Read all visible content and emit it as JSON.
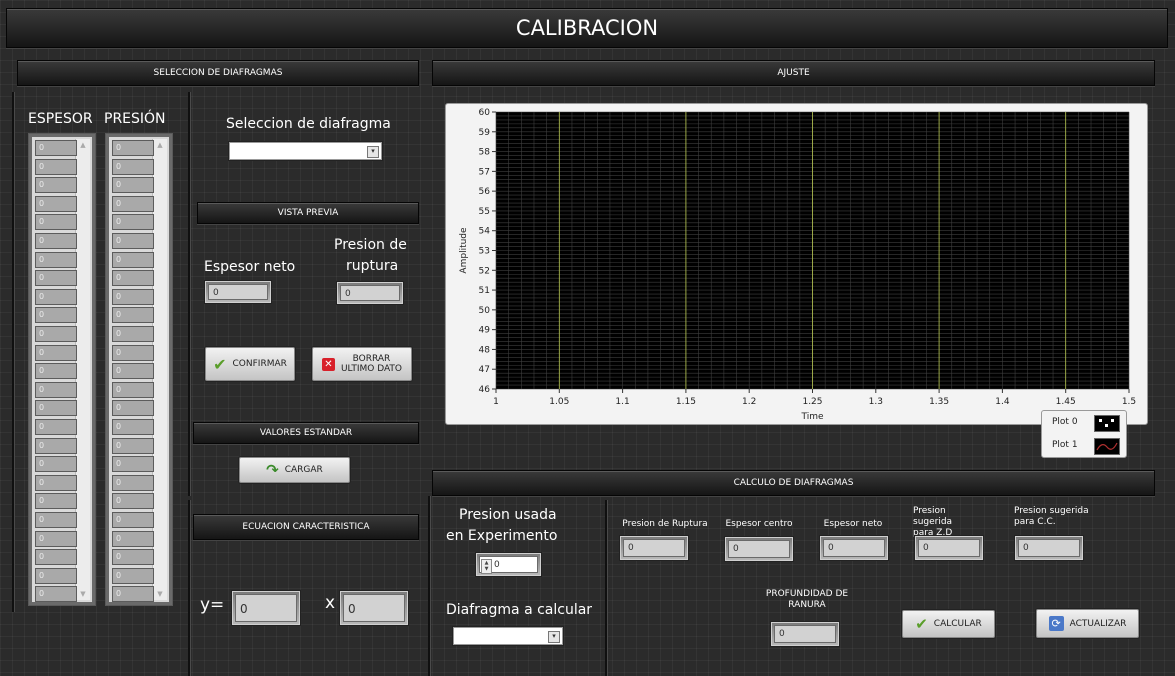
{
  "title": "CALIBRACION",
  "sections": {
    "seleccion": "SELECCION DE DIAFRAGMAS",
    "ajuste": "AJUSTE",
    "vista_previa": "VISTA PREVIA",
    "valores_estandar": "VALORES ESTANDAR",
    "ecuacion": "ECUACION CARACTERISTICA",
    "calculo": "CALCULO DE DIAFRAGMAS"
  },
  "arrays": {
    "espesor_label": "ESPESOR",
    "presion_label": "PRESIÓN",
    "espesor_values": [
      "0",
      "0",
      "0",
      "0",
      "0",
      "0",
      "0",
      "0",
      "0",
      "0",
      "0",
      "0",
      "0",
      "0",
      "0",
      "0",
      "0",
      "0",
      "0",
      "0",
      "0",
      "0",
      "0",
      "0",
      "0"
    ],
    "presion_values": [
      "0",
      "0",
      "0",
      "0",
      "0",
      "0",
      "0",
      "0",
      "0",
      "0",
      "0",
      "0",
      "0",
      "0",
      "0",
      "0",
      "0",
      "0",
      "0",
      "0",
      "0",
      "0",
      "0",
      "0",
      "0"
    ]
  },
  "seleccion": {
    "label": "Seleccion de diafragma",
    "value": ""
  },
  "vista": {
    "espesor_label": "Espesor neto",
    "espesor_value": "0",
    "presion_label_1": "Presion de",
    "presion_label_2": "ruptura",
    "presion_value": "0"
  },
  "buttons": {
    "confirmar": "CONFIRMAR",
    "borrar_1": "BORRAR",
    "borrar_2": "ULTIMO DATO",
    "cargar": "CARGAR",
    "calcular": "CALCULAR",
    "actualizar": "ACTUALIZAR"
  },
  "ecuacion": {
    "y_label": "y=",
    "y_value": "0",
    "x_label": "x",
    "x_value": "0"
  },
  "experimento": {
    "label_1": "Presion usada",
    "label_2": "en Experimento",
    "value": "0",
    "diafragma_label": "Diafragma a calcular",
    "diafragma_value": ""
  },
  "calculo": {
    "presion_ruptura": {
      "label": "Presion de Ruptura",
      "value": "0"
    },
    "espesor_centro": {
      "label": "Espesor centro",
      "value": "0"
    },
    "espesor_neto": {
      "label": "Espesor neto",
      "value": "0"
    },
    "presion_zd": {
      "label_1": "Presion sugerida",
      "label_2": "para Z.D",
      "value": "0"
    },
    "presion_cc": {
      "label_1": "Presion sugerida",
      "label_2": "para C.C.",
      "value": "0"
    },
    "profundidad": {
      "label_1": "PROFUNDIDAD DE",
      "label_2": "RANURA",
      "value": "0"
    }
  },
  "chart_data": {
    "type": "line",
    "title": "",
    "xlabel": "Time",
    "ylabel": "Amplitude",
    "xlim": [
      1,
      1.5
    ],
    "ylim": [
      46,
      60
    ],
    "x_ticks": [
      "1",
      "1.05",
      "1.1",
      "1.15",
      "1.2",
      "1.25",
      "1.3",
      "1.35",
      "1.4",
      "1.45",
      "1.5"
    ],
    "y_ticks": [
      "46",
      "47",
      "48",
      "49",
      "50",
      "51",
      "52",
      "53",
      "54",
      "55",
      "56",
      "57",
      "58",
      "59",
      "60"
    ],
    "grid": true,
    "legend_position": "bottom-right",
    "series": [
      {
        "name": "Plot 0",
        "values": []
      },
      {
        "name": "Plot 1",
        "values": []
      }
    ],
    "colors": {
      "background": "#000000",
      "grid_major": "#b8c850",
      "grid_minor": "#3e3e3e"
    }
  }
}
